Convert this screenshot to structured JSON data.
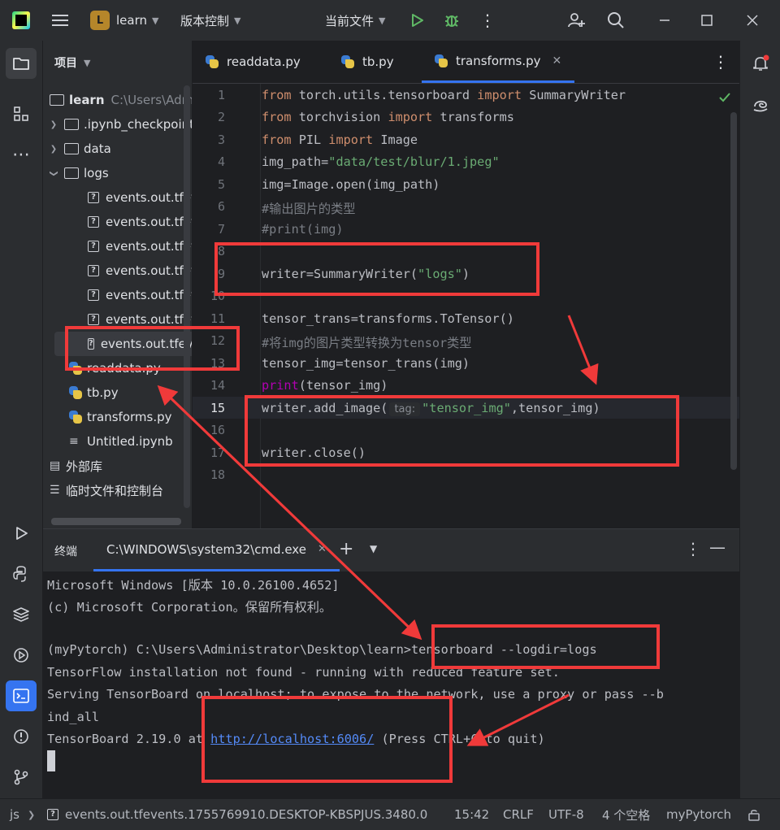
{
  "titlebar": {
    "project_badge": "L",
    "project_name": "learn",
    "vcs_label": "版本控制",
    "run_config": "当前文件"
  },
  "project_panel": {
    "title": "项目",
    "root_name": "learn",
    "root_path": "C:\\Users\\Admin",
    "items": [
      {
        "label": ".ipynb_checkpoints"
      },
      {
        "label": "data"
      },
      {
        "label": "logs"
      },
      {
        "label": "events.out.tfevents"
      },
      {
        "label": "events.out.tfevents"
      },
      {
        "label": "events.out.tfevents"
      },
      {
        "label": "events.out.tfevents"
      },
      {
        "label": "events.out.tfevents"
      },
      {
        "label": "events.out.tfevents"
      },
      {
        "label": "readdata.py"
      },
      {
        "label": "tb.py"
      },
      {
        "label": "transforms.py"
      },
      {
        "label": "Untitled.ipynb"
      },
      {
        "label": "外部库"
      },
      {
        "label": "临时文件和控制台"
      }
    ]
  },
  "tabs": [
    {
      "label": "readdata.py"
    },
    {
      "label": "tb.py"
    },
    {
      "label": "transforms.py"
    }
  ],
  "editor": {
    "line_numbers": [
      "1",
      "2",
      "3",
      "4",
      "5",
      "6",
      "7",
      "8",
      "9",
      "10",
      "11",
      "12",
      "13",
      "14",
      "15",
      "16",
      "17",
      "18"
    ],
    "lines": {
      "l1_a": "from",
      "l1_b": " torch.utils.tensorboard ",
      "l1_c": "import",
      "l1_d": " SummaryWriter",
      "l2_a": "from",
      "l2_b": " torchvision ",
      "l2_c": "import",
      "l2_d": " transforms",
      "l3_a": "from",
      "l3_b": " PIL ",
      "l3_c": "import",
      "l3_d": " Image",
      "l4_a": "img_path=",
      "l4_b": "\"data/test/blur/1.jpeg\"",
      "l5": "img=Image.open(img_path)",
      "l6": "#输出图片的类型",
      "l7": "#print(img)",
      "l9_a": "writer=SummaryWriter(",
      "l9_b": "\"logs\"",
      "l9_c": ")",
      "l11": "tensor_trans=transforms.ToTensor()",
      "l12": "#将img的图片类型转换为tensor类型",
      "l13": "tensor_img=tensor_trans(img)",
      "l14_a": "print",
      "l14_b": "(tensor_img)",
      "l15_a": "writer.add_image(",
      "l15_hint": "tag:",
      "l15_b": "\"tensor_img\"",
      "l15_c": ",tensor_img)",
      "l17": "writer.close()"
    }
  },
  "terminal": {
    "title": "终端",
    "tab_label": "C:\\WINDOWS\\system32\\cmd.exe",
    "lines": {
      "t1": "Microsoft Windows [版本 10.0.26100.4652]",
      "t2": "(c) Microsoft Corporation。保留所有权利。",
      "t3": "(myPytorch) C:\\Users\\Administrator\\Desktop\\learn>tensorboard --logdir=logs",
      "t4": "TensorFlow installation not found - running with reduced feature set.",
      "t5": "Serving TensorBoard on localhost; to expose to the network, use a proxy or pass --b",
      "t6": "ind_all",
      "t7_a": "TensorBoard 2.19.0 at ",
      "t7_link": "http://localhost:6006/",
      "t7_b": " (Press CTRL+C to quit)"
    }
  },
  "statusbar": {
    "breadcrumb_root": "js",
    "file": "events.out.tfevents.1755769910.DESKTOP-KBSPJUS.3480.0",
    "position": "15:42",
    "line_sep": "CRLF",
    "encoding": "UTF-8",
    "indent": "4 个空格",
    "interpreter": "myPytorch"
  },
  "colors": {
    "annotation_red": "#f03a3a",
    "keyword": "#cf8e6d",
    "string": "#6aab73",
    "comment": "#7a7e85",
    "builtin": "#b200b2",
    "link": "#548af7"
  }
}
